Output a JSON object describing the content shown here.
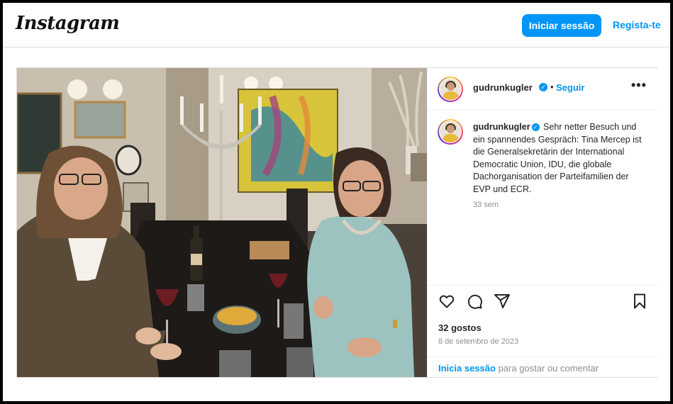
{
  "header": {
    "logo": "Instagram",
    "login_button": "Iniciar sessão",
    "register_link": "Regista-te"
  },
  "post": {
    "username": "gudrunkugler",
    "follow_label": "Seguir",
    "separator": "•",
    "more_label": "•••",
    "caption_text": "Sehr netter Besuch und ein spannendes Gespräch: Tina Mercep ist die Generalsekretärin der International Democratic Union, IDU, die globale Dachorganisation der Parteifamilien der EVP und ECR.",
    "time_ago": "33 sem",
    "likes": "32 gostos",
    "date": "8 de setembro de 2023",
    "login_prompt_link": "Inicia sessão",
    "login_prompt_text": " para gostar ou comentar"
  },
  "icons": [
    "heart-icon",
    "comment-icon",
    "share-icon",
    "bookmark-icon",
    "verified-icon",
    "more-icon"
  ],
  "colors": {
    "accent": "#0095f6",
    "text": "#262626",
    "muted": "#8e8e8e",
    "border": "#dbdbdb"
  }
}
